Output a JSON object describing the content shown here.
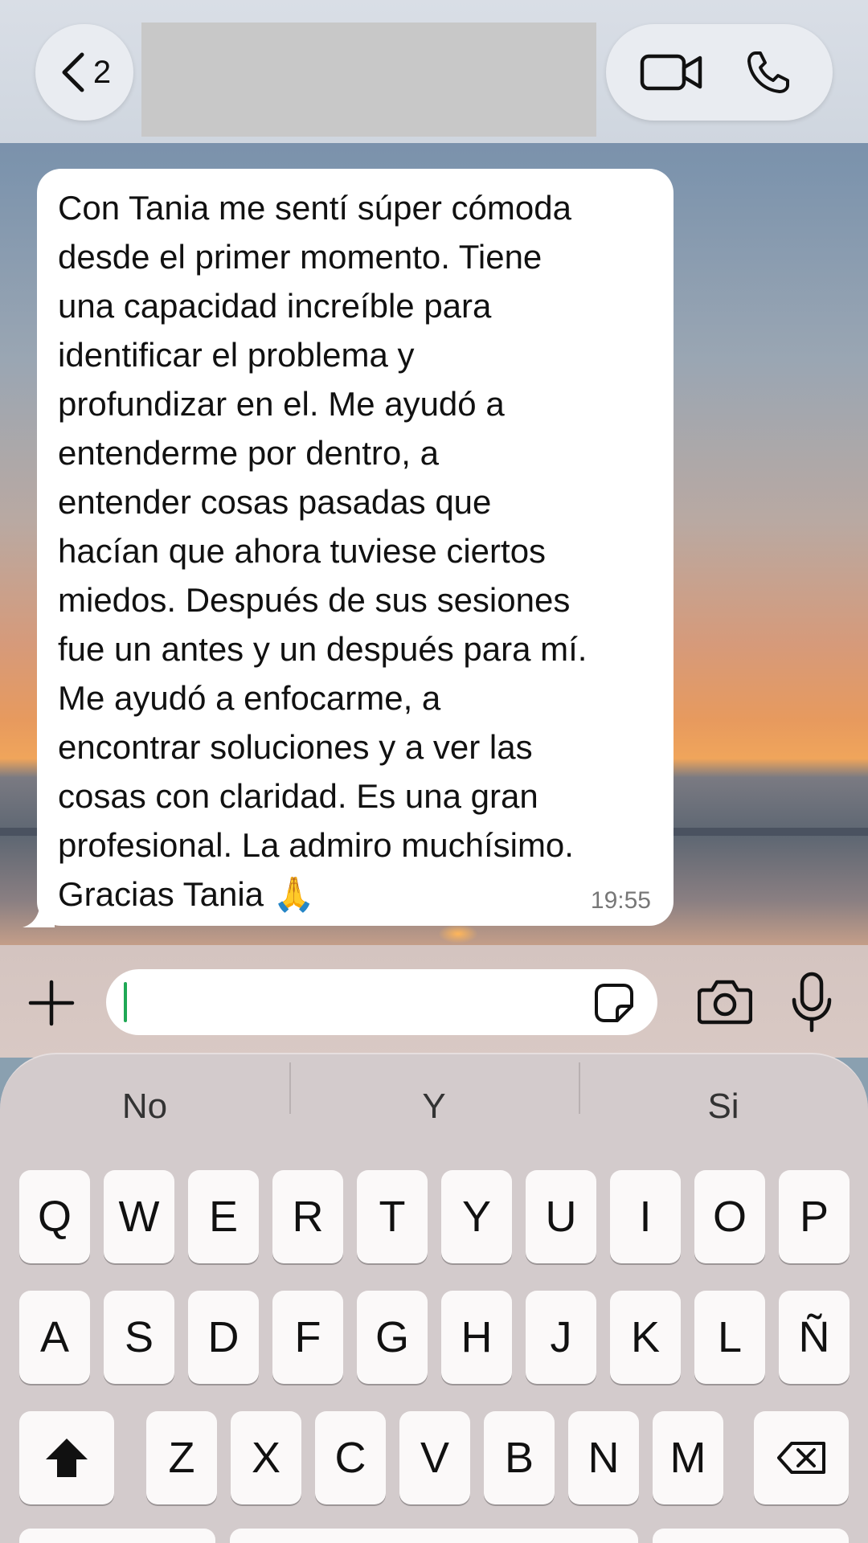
{
  "header": {
    "back_count": "2",
    "icons": [
      "chevron-left-icon",
      "video-camera-icon",
      "phone-icon"
    ]
  },
  "message": {
    "text": "Con Tania me sentí súper cómoda\ndesde el primer momento. Tiene\nuna capacidad increíble para\nidentificar el problema y\nprofundizar en el. Me ayudó a\nentenderme por dentro, a\nentender cosas pasadas que\nhacían que ahora tuviese ciertos\nmiedos. Después de sus sesiones\nfue un antes y un después para mí.\nMe ayudó a enfocarme, a\nencontrar soluciones y a ver las\ncosas con claridad. Es una gran\nprofesional. La admiro muchísimo.\nGracias Tania 🙏",
    "time": "19:55"
  },
  "composer": {
    "value": "",
    "icons": [
      "plus-icon",
      "sticker-icon",
      "camera-icon",
      "microphone-icon"
    ]
  },
  "keyboard": {
    "suggestions": [
      "No",
      "Y",
      "Si"
    ],
    "row1": [
      "Q",
      "W",
      "E",
      "R",
      "T",
      "Y",
      "U",
      "I",
      "O",
      "P"
    ],
    "row2": [
      "A",
      "S",
      "D",
      "F",
      "G",
      "H",
      "J",
      "K",
      "L",
      "Ñ"
    ],
    "row3": [
      "Z",
      "X",
      "C",
      "V",
      "B",
      "N",
      "M"
    ]
  }
}
